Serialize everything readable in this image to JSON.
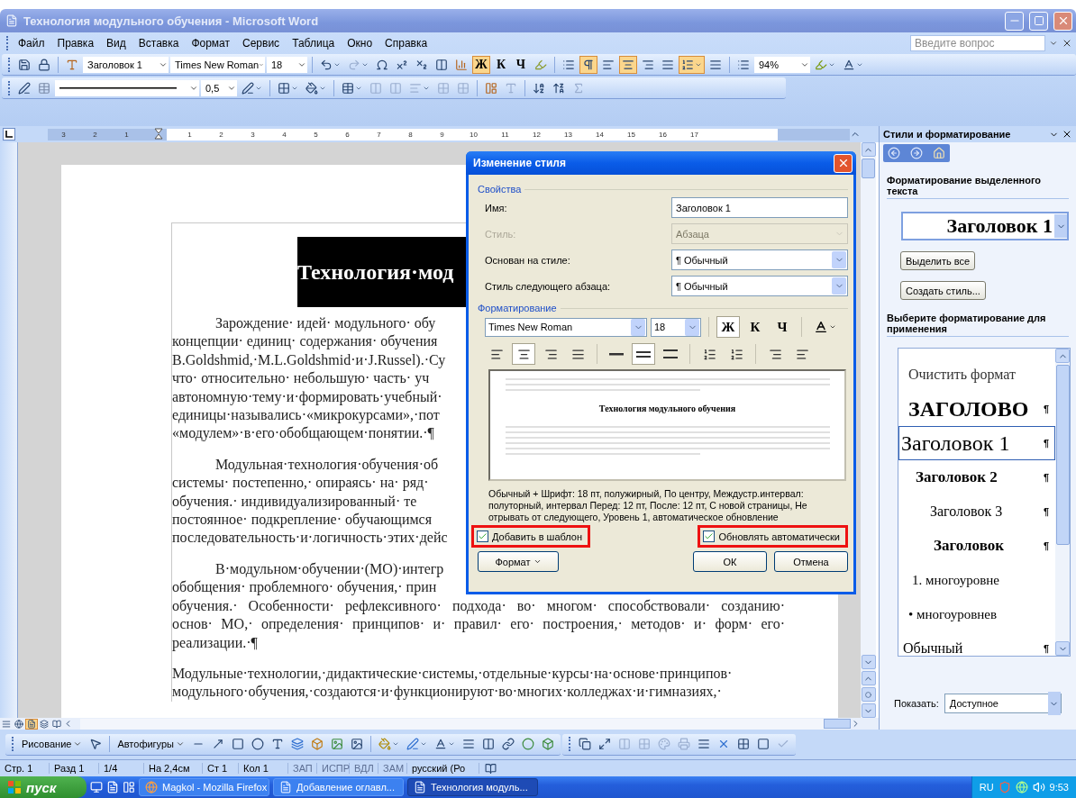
{
  "window": {
    "title": "Технология модульного обучения - Microsoft Word"
  },
  "menu": [
    "Файл",
    "Правка",
    "Вид",
    "Вставка",
    "Формат",
    "Сервис",
    "Таблица",
    "Окно",
    "Справка"
  ],
  "help_search": {
    "placeholder": "Введите вопрос"
  },
  "formatting_toolbar": {
    "style": "Заголовок 1",
    "font": "Times New Roman",
    "size": "18",
    "text_toggles": [
      {
        "label": "Ж",
        "on": true
      },
      {
        "label": "К",
        "on": false
      },
      {
        "label": "Ч",
        "on": false
      }
    ],
    "show_marks": true,
    "alignment": [
      {
        "selected": false
      },
      {
        "selected": true
      },
      {
        "selected": false
      },
      {
        "selected": false
      }
    ],
    "line_spacing": true,
    "zoom": "94%"
  },
  "drawing_toolbar_top": {
    "line_weight": "0,5"
  },
  "ruler": {
    "left_marks": [
      "3",
      "2",
      "1"
    ],
    "marks": [
      "1",
      "2",
      "3",
      "4",
      "5",
      "6",
      "7",
      "8",
      "9",
      "10",
      "11",
      "12",
      "13",
      "14",
      "15",
      "16",
      "17"
    ]
  },
  "document": {
    "heading": "Технология·мод",
    "paragraphs": [
      {
        "indent": true,
        "lines": [
          {
            "text": "Зарождение· идей· модульного· обу",
            "justified": false
          },
          {
            "text": "концепции· единиц· содержания· обучения",
            "justified": false
          },
          {
            "text": "B.Goldshmid,·M.L.Goldshmid·и·J.Russel).·Су",
            "justified": false
          },
          {
            "text": "что· относительно· небольшую· часть· уч",
            "justified": false
          },
          {
            "text": "автономную·тему·и·формировать·учебный·",
            "justified": false
          },
          {
            "text": "единицы·назывались·«микрокурсами»,·пот",
            "justified": false
          },
          {
            "text": "«модулем»·в·его·обобщающем·понятии.·¶",
            "justified": false
          }
        ]
      },
      {
        "indent": true,
        "lines": [
          {
            "text": "Модульная·технология·обучения·об",
            "justified": false
          },
          {
            "text": "системы· постепенно,· опираясь· на· ряд·",
            "justified": false
          },
          {
            "text": "обучения.· индивидуализированный· те",
            "justified": false
          },
          {
            "text": "постоянное· подкрепление· обучающимся",
            "justified": false
          },
          {
            "text": "последовательность·и·логичность·этих·дейс",
            "justified": false
          }
        ]
      },
      {
        "indent": true,
        "lines": [
          {
            "text": "В·модульном·обучении·(МО)·интегр",
            "justified": false
          },
          {
            "text": "обобщения· проблемного· обучения,· прин",
            "justified": false
          },
          {
            "text": "обучения.· Особенности· рефлексивного· подхода· во· многом· способствовали· созданию·",
            "justified": true
          },
          {
            "text": "основ· МО,· определения· принципов· и· правил· его· построения,· методов· и· форм· его·",
            "justified": true
          },
          {
            "text": "реализации.·¶",
            "justified": false
          }
        ]
      },
      {
        "indent": false,
        "lines": [
          {
            "text": "Модульные·технологии,·дидактические·системы,·отдельные·курсы·на·основе·принципов·",
            "justified": false
          },
          {
            "text": "модульного·обучения,·создаются·и·функционируют·во·многих·колледжах·и·гимназиях,·",
            "justified": false
          }
        ]
      }
    ]
  },
  "view_buttons": [
    {
      "selected": false
    },
    {
      "selected": false
    },
    {
      "selected": true
    },
    {
      "selected": false
    },
    {
      "selected": false
    }
  ],
  "dialog": {
    "title": "Изменение стиля",
    "properties_label": "Свойства",
    "fields": [
      {
        "label": "Имя:",
        "value": "Заголовок 1",
        "kind": "text",
        "disabled": false
      },
      {
        "label": "Стиль:",
        "value": "Абзаца",
        "kind": "select",
        "disabled": true
      },
      {
        "label": "Основан на стиле:",
        "value": "¶ Обычный",
        "kind": "select",
        "disabled": false
      },
      {
        "label": "Стиль следующего абзаца:",
        "value": "¶ Обычный",
        "kind": "select",
        "disabled": false
      }
    ],
    "formatting_label": "Форматирование",
    "font": "Times New Roman",
    "size": "18",
    "text_toggles": [
      {
        "label": "Ж",
        "on": true
      },
      {
        "label": "К",
        "on": false
      },
      {
        "label": "Ч",
        "on": false
      }
    ],
    "alignment": [
      {
        "selected": false
      },
      {
        "selected": true
      },
      {
        "selected": false
      },
      {
        "selected": false
      }
    ],
    "spacing": [
      {
        "selected": false
      },
      {
        "selected": true
      },
      {
        "selected": false
      }
    ],
    "preview_text": "Технология модульного обучения",
    "description": "Обычный + Шрифт: 18 пт, полужирный, По центру, Междустр.интервал: полуторный, интервал Перед: 12 пт, После: 12 пт, С новой страницы, Не отрывать от следующего, Уровень 1, автоматическое обновление",
    "checkboxes": [
      {
        "label": "Добавить в шаблон",
        "checked": true,
        "highlighted": true
      },
      {
        "label": "Обновлять автоматически",
        "checked": true,
        "highlighted": true
      }
    ],
    "format_button": "Формат",
    "ok_button": "ОК",
    "cancel_button": "Отмена"
  },
  "task_pane": {
    "title": "Стили и форматирование",
    "selection_label": "Форматирование выделенного текста",
    "current_style": "Заголовок 1",
    "buttons": [
      "Выделить все",
      "Создать стиль..."
    ],
    "apply_label": "Выберите форматирование для применения",
    "styles": [
      {
        "label": "Очистить формат",
        "kind": "clear",
        "selected": false
      },
      {
        "label": "ЗАГОЛОВО",
        "mark": "¶",
        "kind": "title",
        "selected": false
      },
      {
        "label": "Заголовок 1",
        "mark": "¶",
        "kind": "h1",
        "selected": true
      },
      {
        "label": "Заголовок 2",
        "mark": "¶",
        "kind": "h2",
        "selected": false
      },
      {
        "label": "Заголовок 3",
        "mark": "¶",
        "kind": "h3",
        "selected": false
      },
      {
        "label": "Заголовок",
        "mark": "¶",
        "kind": "h4",
        "selected": false
      },
      {
        "label": "1.  многоуровне",
        "kind": "numbered",
        "selected": false
      },
      {
        "label": "• многоуровнев",
        "kind": "bullet",
        "selected": false
      },
      {
        "label": "Обычный",
        "mark": "¶",
        "kind": "normal",
        "selected": false
      }
    ],
    "show_label": "Показать:",
    "show_value": "Доступное"
  },
  "drawing_toolbar": {
    "draw_menu": "Рисование",
    "autoshapes": "Автофигуры"
  },
  "status_bar": [
    {
      "label": "Стр. 1",
      "disabled": false
    },
    {
      "label": "Разд 1",
      "disabled": false
    },
    {
      "label": "1/4",
      "disabled": false
    },
    {
      "label": "На 2,4см",
      "disabled": false
    },
    {
      "label": "Ст 1",
      "disabled": false
    },
    {
      "label": "Кол 1",
      "disabled": false
    },
    {
      "label": "ЗАП",
      "disabled": true
    },
    {
      "label": "ИСПР",
      "disabled": true
    },
    {
      "label": "ВДЛ",
      "disabled": true
    },
    {
      "label": "ЗАМ",
      "disabled": true
    },
    {
      "label": "русский (Ро",
      "disabled": false
    }
  ],
  "taskbar": {
    "start": "пуск",
    "tasks": [
      {
        "label": "Magkol - Mozilla Firefox",
        "selected": false
      },
      {
        "label": "Добавление оглавл...",
        "selected": false
      },
      {
        "label": "Технология модуль...",
        "selected": true
      }
    ],
    "language": "RU",
    "clock": "9:53"
  }
}
